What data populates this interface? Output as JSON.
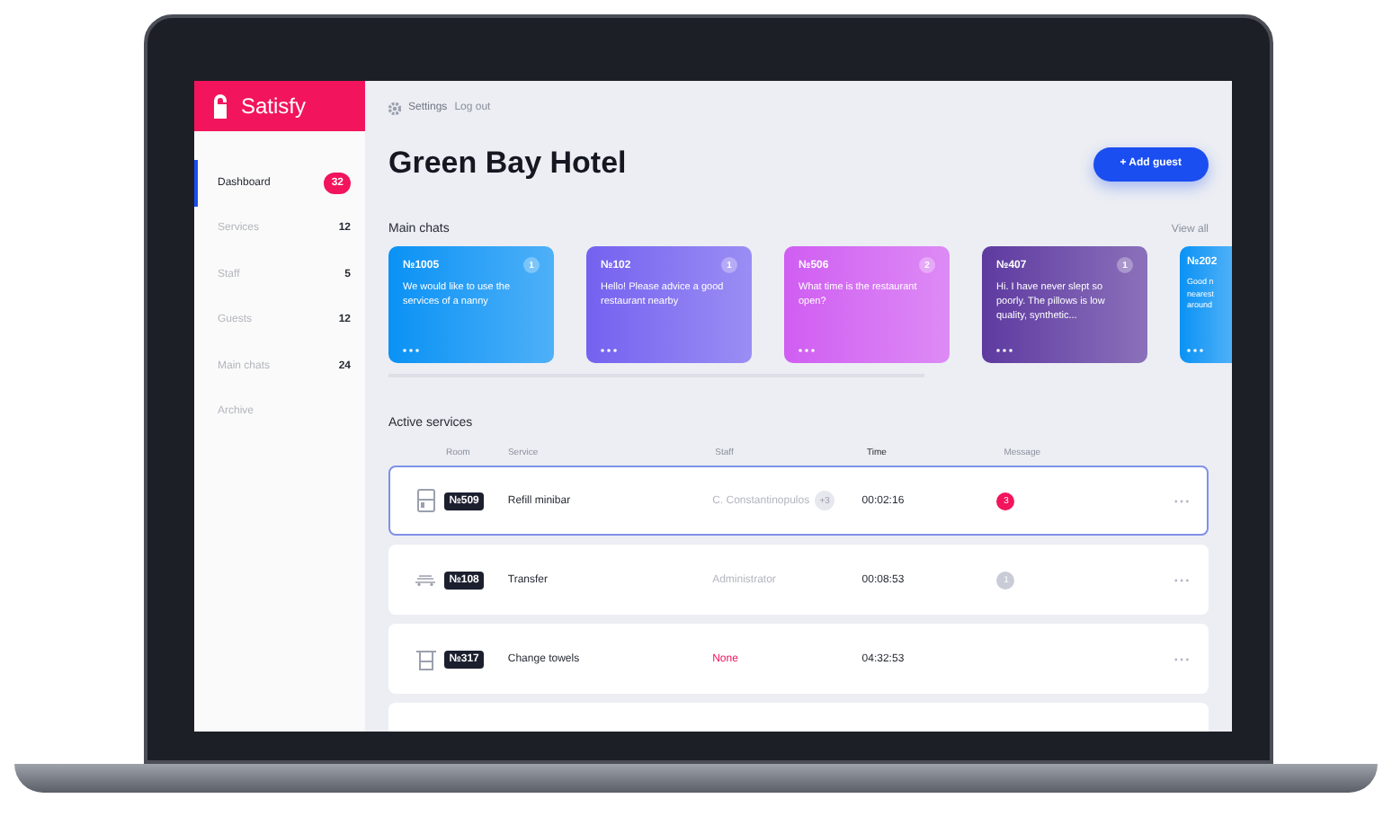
{
  "app": {
    "name": "Satisfy"
  },
  "sidebar": {
    "items": [
      {
        "label": "Dashboard",
        "count": "32",
        "selected": true
      },
      {
        "label": "Services",
        "count": "12",
        "selected": false
      },
      {
        "label": "Staff",
        "count": "5",
        "selected": false
      },
      {
        "label": "Guests",
        "count": "12",
        "selected": false
      },
      {
        "label": "Main chats",
        "count": "24",
        "selected": false
      },
      {
        "label": "Archive",
        "selected": false
      }
    ]
  },
  "topbar": {
    "links": [
      "Settings",
      "Log out"
    ]
  },
  "title": "Green Bay Hotel",
  "add_button": "+ Add guest",
  "main_chats": {
    "label": "Main chats",
    "view_all": "View all",
    "cards": [
      {
        "room": "№1005",
        "badge": "1",
        "message": "We would like to use the services of a nanny",
        "color": "#0a92f5"
      },
      {
        "room": "№102",
        "badge": "1",
        "message": "Hello! Please advice a good restaurant nearby",
        "color": "#7462f0"
      },
      {
        "room": "№506",
        "badge": "2",
        "message": "What time is the restaurant open?",
        "color": "#d05ef2"
      },
      {
        "room": "№407",
        "badge": "1",
        "message": "Hi. I have never slept so poorly. The pillows is low quality, synthetic...",
        "color": "#5e3aa0"
      },
      {
        "room": "№202",
        "message": "Good n nearest around",
        "color": "#0a92f5"
      }
    ]
  },
  "active_services": {
    "label": "Active services",
    "columns": [
      "Room",
      "Service",
      "Staff",
      "Time",
      "Message"
    ],
    "rows": [
      {
        "kind": "minibar",
        "room": "№509",
        "service": "Refill minibar",
        "staff": "C. Constantinopulos",
        "staff_extra": "+3",
        "assigned": true,
        "time": "00:02:16",
        "message": "3",
        "unread": true,
        "selected": true
      },
      {
        "kind": "transfer",
        "room": "№108",
        "service": "Transfer",
        "staff": "Administrator",
        "assigned": true,
        "time": "00:08:53",
        "message": "1",
        "unread": false,
        "selected": false
      },
      {
        "kind": "towels",
        "room": "№317",
        "service": "Change towels",
        "staff": "None",
        "assigned": false,
        "time": "04:32:53",
        "selected": false
      }
    ]
  }
}
